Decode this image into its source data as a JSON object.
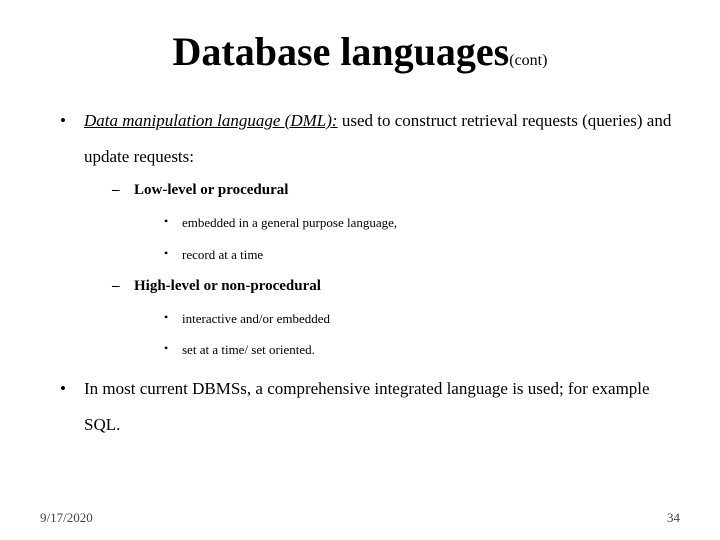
{
  "title": {
    "main": "Database languages",
    "cont": "(cont)"
  },
  "bullets": [
    {
      "dml_label": "Data manipulation language (DML):",
      "dml_rest": " used to construct retrieval requests (queries) and update requests:",
      "sub": [
        {
          "label": "Low-level or procedural",
          "items": [
            "embedded in a general purpose language,",
            "record at a time"
          ]
        },
        {
          "label": "High-level or non-procedural",
          "items": [
            "interactive and/or embedded",
            "set at a time/ set oriented."
          ]
        }
      ]
    },
    {
      "text": "In most current DBMSs, a comprehensive integrated language is used; for example SQL."
    }
  ],
  "footer": {
    "date": "9/17/2020",
    "page": "34"
  }
}
